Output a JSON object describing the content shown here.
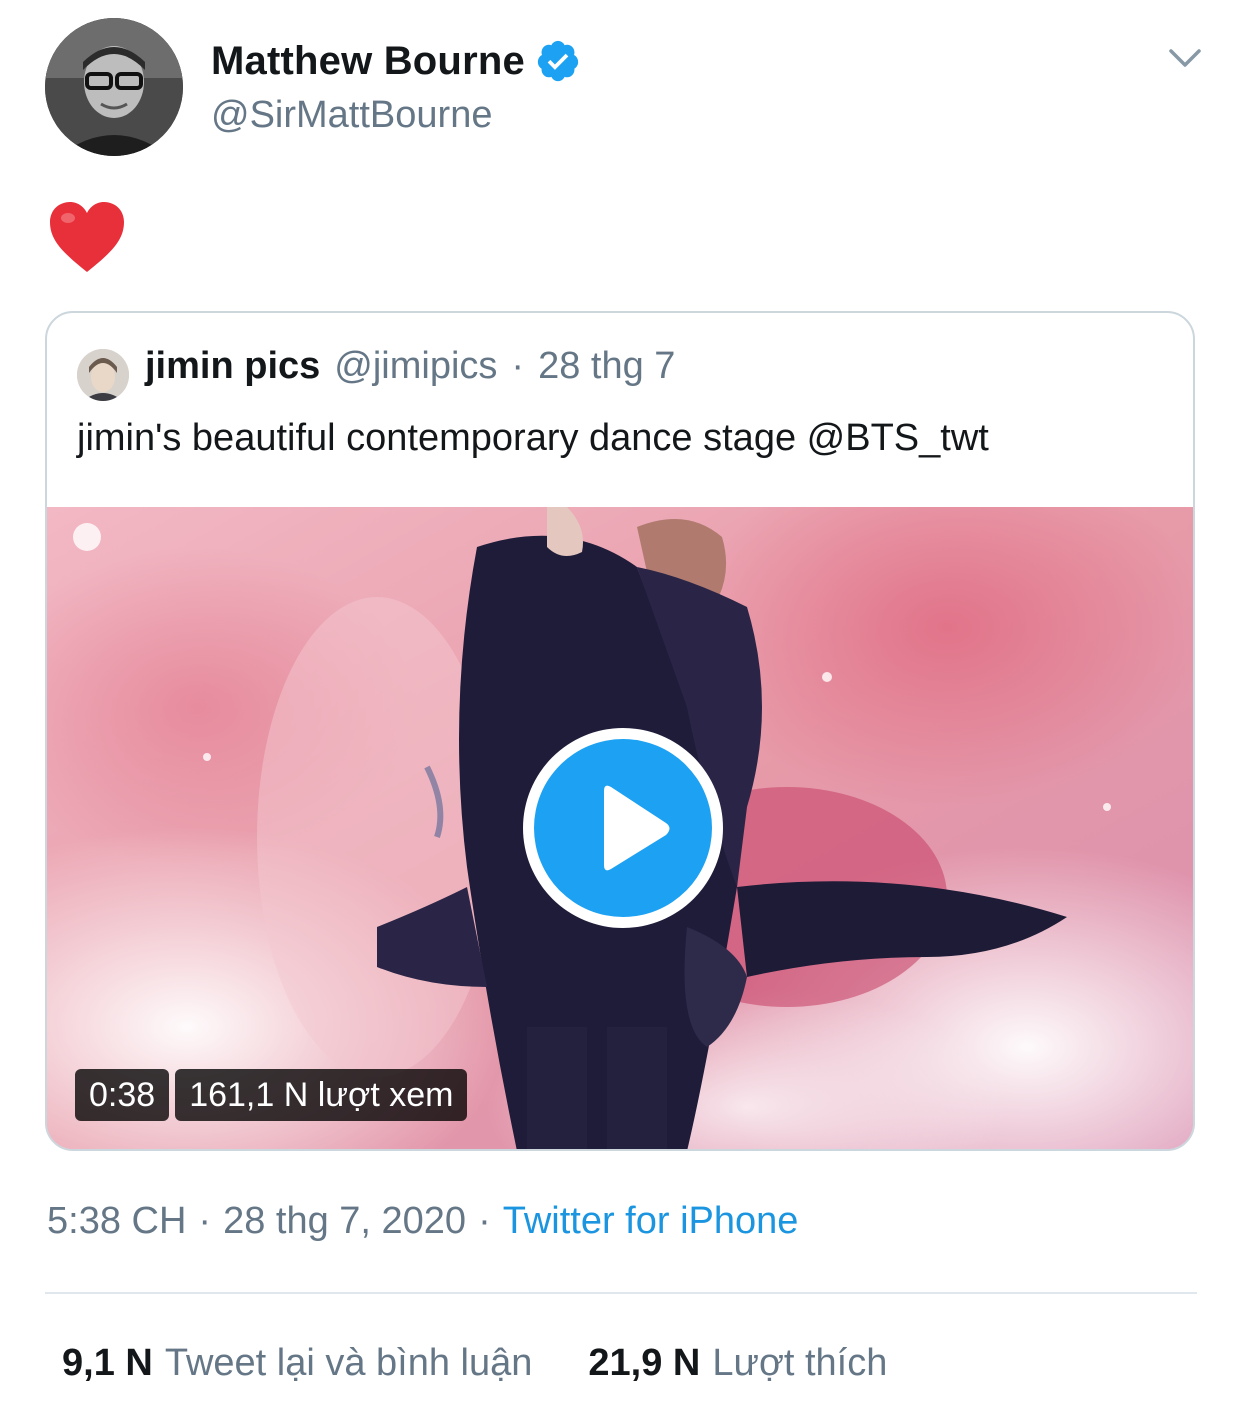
{
  "author": {
    "display_name": "Matthew Bourne",
    "handle": "@SirMattBourne",
    "verified": true,
    "avatar_icon": "profile-photo"
  },
  "tweet": {
    "text_emoji": "heart-emoji",
    "timestamp": "5:38 CH",
    "separator": "·",
    "date": "28 thg 7, 2020",
    "source": "Twitter for iPhone"
  },
  "quoted_tweet": {
    "display_name": "jimin pics",
    "handle": "@jimipics",
    "separator": "·",
    "date": "28 thg 7",
    "text": "jimin's beautiful contemporary dance stage @BTS_twt",
    "media": {
      "duration": "0:38",
      "views": "161,1 N lượt xem"
    }
  },
  "stats": {
    "retweets_count": "9,1 N",
    "retweets_label": "Tweet lại và bình luận",
    "likes_count": "21,9 N",
    "likes_label": "Lượt thích"
  },
  "colors": {
    "accent": "#1da1f2",
    "link": "#1b95e0",
    "muted_text": "#657786",
    "border": "#ccd6dd",
    "heart": "#e0245e"
  }
}
